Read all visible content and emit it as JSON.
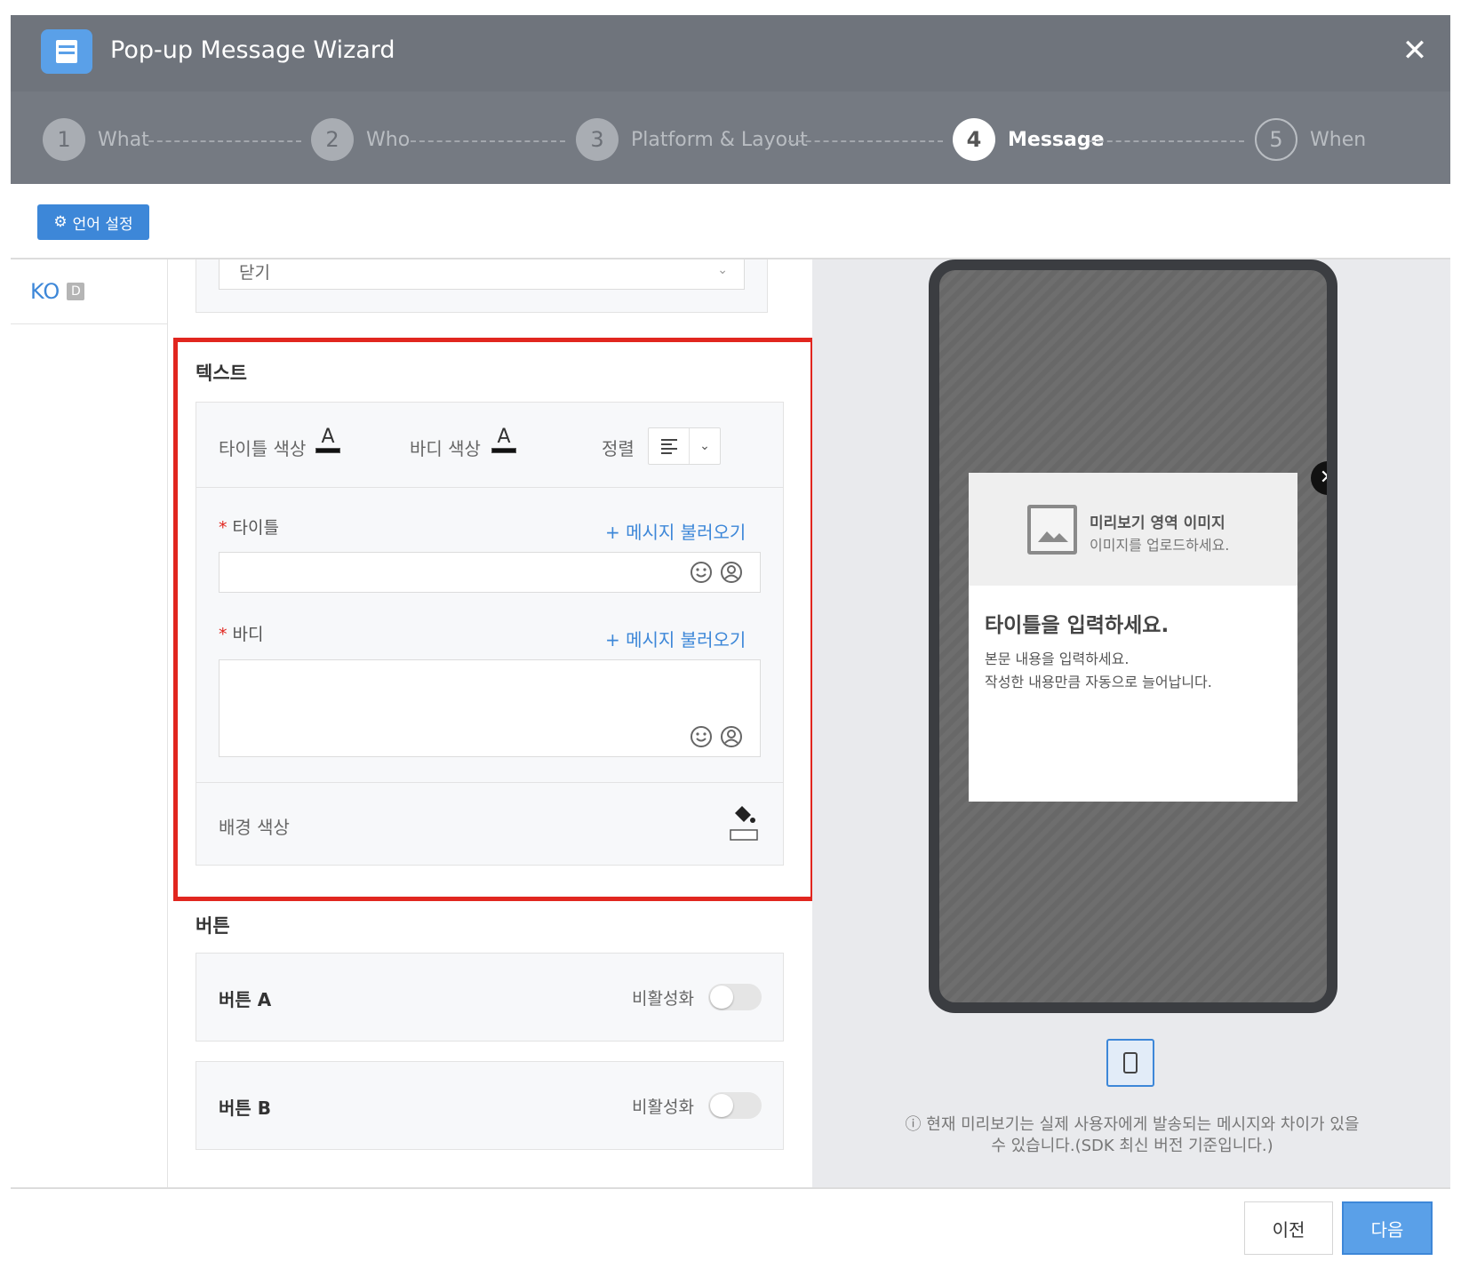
{
  "window": {
    "title": "Pop-up Message Wizard",
    "icon": "document-icon",
    "close_icon": "close-icon"
  },
  "steps": [
    {
      "num": "1",
      "label": "What",
      "state": "done"
    },
    {
      "num": "2",
      "label": "Who",
      "state": "done"
    },
    {
      "num": "3",
      "label": "Platform & Layout",
      "state": "done"
    },
    {
      "num": "4",
      "label": "Message",
      "state": "active"
    },
    {
      "num": "5",
      "label": "When",
      "state": "upcoming"
    }
  ],
  "language_settings": {
    "label": "언어 설정",
    "icon": "gear-icon"
  },
  "languages": [
    {
      "code": "KO",
      "badge": "D"
    }
  ],
  "previous_section": {
    "selected_value": "닫기"
  },
  "text_section": {
    "heading": "텍스트",
    "title_color_label": "타이틀 색상",
    "body_color_label": "바디 색상",
    "color_glyph": "A",
    "align_label": "정렬",
    "title_field": {
      "label": "타이틀",
      "required": "*",
      "load_link": "+ 메시지 불러오기",
      "value": ""
    },
    "body_field": {
      "label": "바디",
      "required": "*",
      "load_link": "+ 메시지 불러오기",
      "value": ""
    },
    "bg_color_label": "배경 색상",
    "colors": {
      "title": "#111111",
      "body": "#111111",
      "background": "#ffffff"
    }
  },
  "button_section": {
    "heading": "버튼",
    "buttons": [
      {
        "name": "버튼 A",
        "state_label": "비활성화",
        "enabled": false
      },
      {
        "name": "버튼 B",
        "state_label": "비활성화",
        "enabled": false
      }
    ]
  },
  "preview": {
    "image_title": "미리보기 영역 이미지",
    "image_subtitle": "이미지를 업로드하세요.",
    "popup_title": "타이틀을 입력하세요.",
    "popup_body_line1": "본문 내용을 입력하세요.",
    "popup_body_line2": "작성한 내용만큼 자동으로 늘어납니다.",
    "notice_line1": "ⓘ 현재 미리보기는 실제 사용자에게 발송되는 메시지와 차이가 있을",
    "notice_line2": "수 있습니다.(SDK 최신 버전 기준입니다.)"
  },
  "footer": {
    "prev_label": "이전",
    "next_label": "다음"
  },
  "theme": {
    "accent": "#3d87d8",
    "highlight": "#e1261f",
    "header_bg": "#757a82"
  }
}
